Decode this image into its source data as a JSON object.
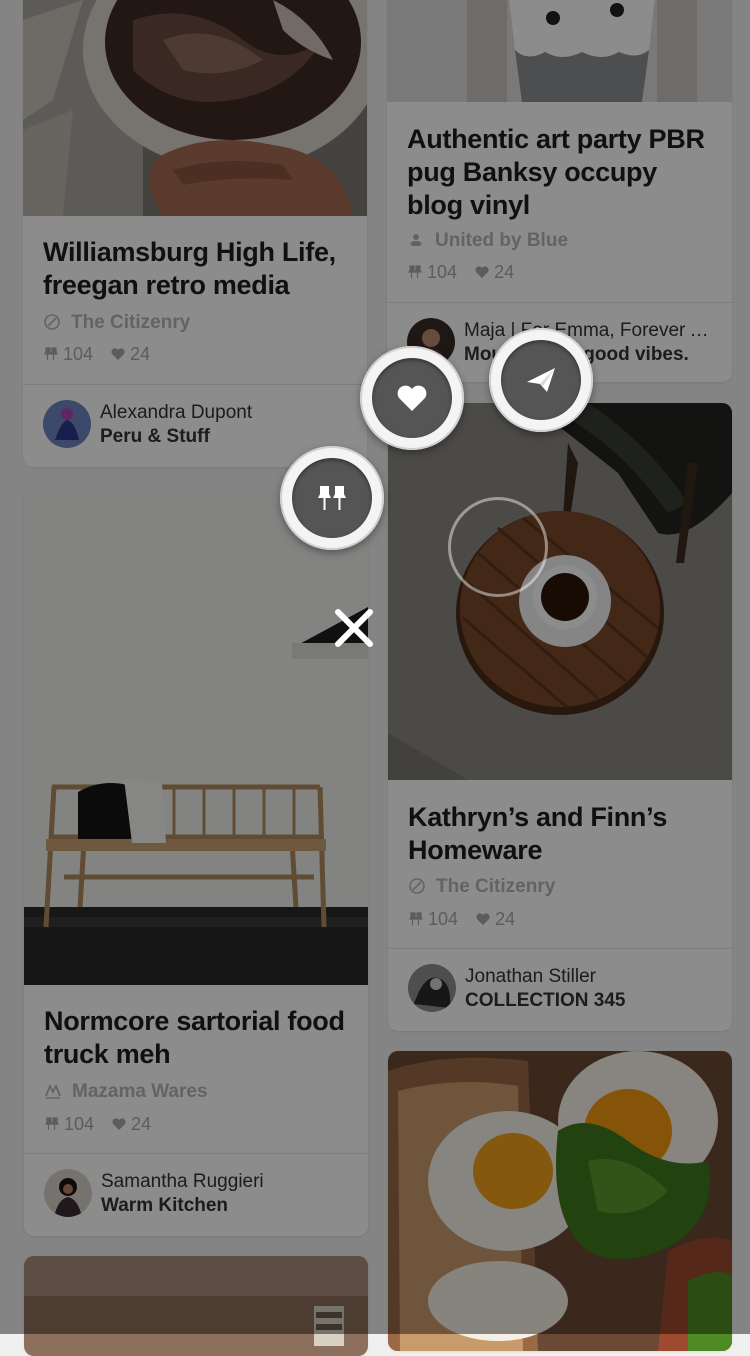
{
  "pins": [
    {
      "title": "Williamsburg High Life, freegan retro media",
      "source": "The Citizenry",
      "source_icon": "citizenry-logo-icon",
      "pins": "104",
      "likes": "24",
      "user_name": "Alexandra Dupont",
      "collection": "Peru & Stuff"
    },
    {
      "title": "Authentic art party PBR pug Banksy occupy blog vinyl",
      "source": "United by Blue",
      "source_icon": "united-by-blue-logo-icon",
      "pins": "104",
      "likes": "24",
      "user_name": "Maja | For Emma, Forever Ago",
      "collection": "Mountains & good vibes."
    },
    {
      "title": "Normcore sartorial food truck meh",
      "source": "Mazama Wares",
      "source_icon": "mazama-logo-icon",
      "pins": "104",
      "likes": "24",
      "user_name": "Samantha Ruggieri",
      "collection": "Warm Kitchen"
    },
    {
      "title": "Kathryn’s and Finn’s Homeware",
      "source": "The Citizenry",
      "source_icon": "citizenry-logo-icon",
      "pins": "104",
      "likes": "24",
      "user_name": "Jonathan Stiller",
      "collection": "COLLECTION 345"
    }
  ],
  "actions": {
    "pin_icon": "pin-icon",
    "like_icon": "heart-icon",
    "send_icon": "paper-plane-icon",
    "close_icon": "close-icon"
  },
  "colors": {
    "overlay": "#000000",
    "button_inner": "#555555",
    "button_ring": "#f4f4f4",
    "title_text": "#1e1e1e",
    "muted_text": "#b5b5b5"
  }
}
